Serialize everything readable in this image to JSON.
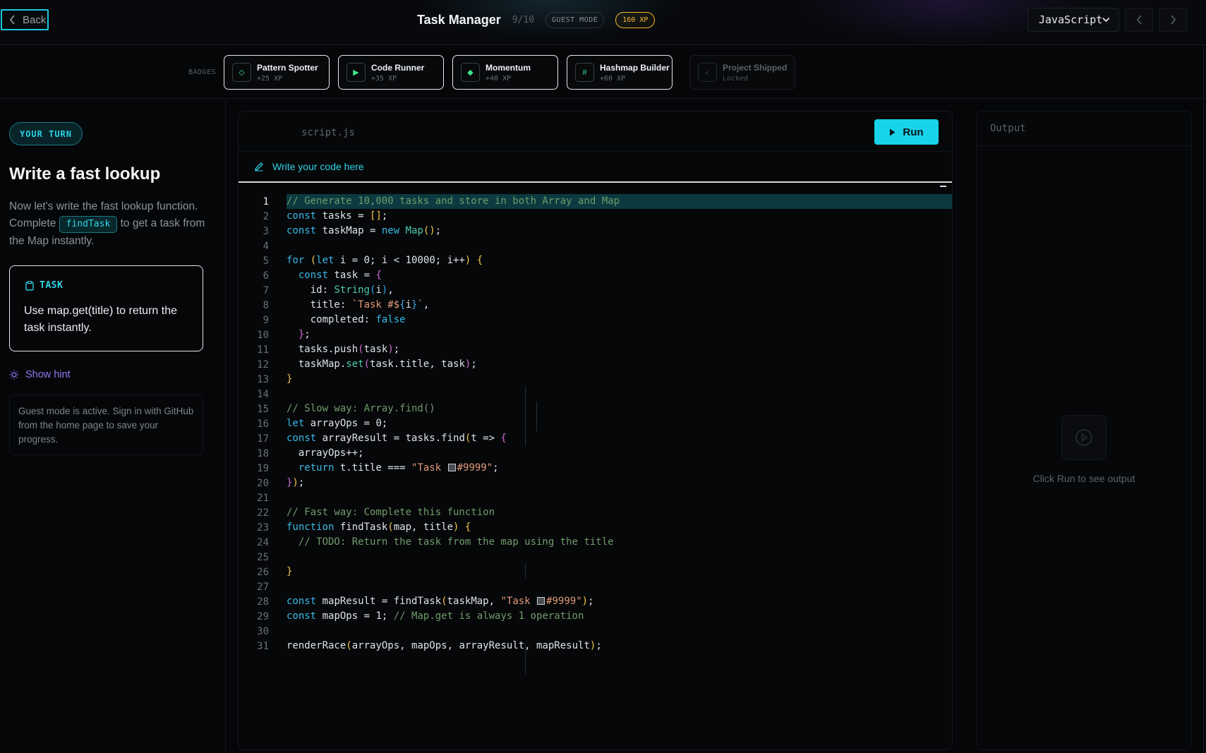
{
  "header": {
    "back_label": "Back",
    "title": "Task Manager",
    "progress": "9/10",
    "guest_pill": "GUEST MODE",
    "xp_pill": "160 XP",
    "language": "JavaScript"
  },
  "badges": {
    "label": "BADGES",
    "items": [
      {
        "name": "Pattern Spotter",
        "sub": "+25 XP",
        "icon": "◇"
      },
      {
        "name": "Code Runner",
        "sub": "+35 XP",
        "icon": "▶"
      },
      {
        "name": "Momentum",
        "sub": "+40 XP",
        "icon": "◆"
      },
      {
        "name": "Hashmap Builder",
        "sub": "+60 XP",
        "icon": "#"
      },
      {
        "name": "Project Shipped",
        "sub": "Locked",
        "icon": "✓"
      }
    ]
  },
  "lesson": {
    "tag": "YOUR TURN",
    "title": "Write a fast lookup",
    "desc_before": "Now let's write the fast lookup function. Complete ",
    "desc_code": "findTask",
    "desc_after": " to get a task from the Map instantly.",
    "task_label": "TASK",
    "task_text": "Use map.get(title) to return the task instantly.",
    "hint_label": "Show hint",
    "guest_note": "Guest mode is active. Sign in with GitHub from the home page to save your progress."
  },
  "editor": {
    "filename": "script.js",
    "run_label": "Run",
    "write_prompt": "Write your code here",
    "lines": [
      "// Generate 10,000 tasks and store in both Array and Map",
      "const tasks = [];",
      "const taskMap = new Map();",
      "",
      "for (let i = 0; i < 10000; i++) {",
      "  const task = {",
      "    id: String(i),",
      "    title: `Task #${i}`,",
      "    completed: false",
      "  };",
      "  tasks.push(task);",
      "  taskMap.set(task.title, task);",
      "}",
      "",
      "// Slow way: Array.find()",
      "let arrayOps = 0;",
      "const arrayResult = tasks.find(t => {",
      "  arrayOps++;",
      "  return t.title === \"Task #9999\";",
      "});",
      "",
      "// Fast way: Complete this function",
      "function findTask(map, title) {",
      "  // TODO: Return the task from the map using the title",
      "",
      "}",
      "",
      "const mapResult = findTask(taskMap, \"Task #9999\");",
      "const mapOps = 1; // Map.get is always 1 operation",
      "",
      "renderRace(arrayOps, mapOps, arrayResult, mapResult);"
    ]
  },
  "output": {
    "title": "Output",
    "empty_text": "Click Run to see output"
  },
  "colors": {
    "accent": "#19d3ea",
    "xp": "#f5b731",
    "hint": "#8c7bf2"
  }
}
